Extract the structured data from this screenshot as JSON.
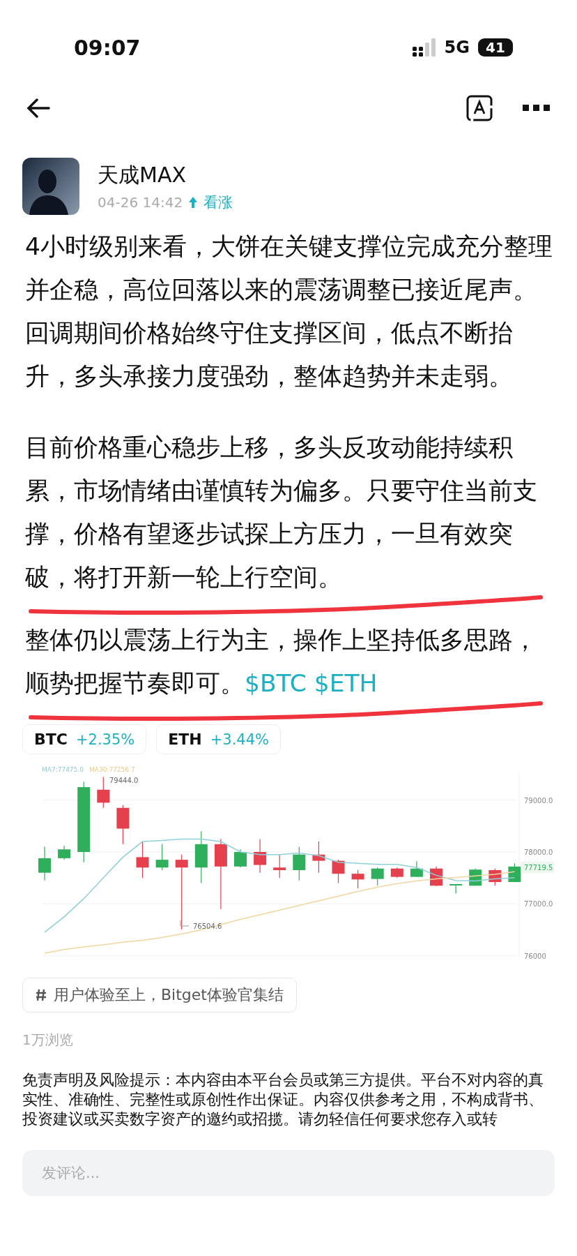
{
  "status_bar": {
    "time": "09:07",
    "network": "5G",
    "battery": "41"
  },
  "author": {
    "name": "天成MAX",
    "time": "04-26 14:42",
    "sentiment": "看涨"
  },
  "paragraphs": [
    {
      "text": "4小时级别来看，大饼在关键支撑位完成充分整理并企稳，高位回落以来的震荡调整已接近尾声。回调期间价格始终守住支撑区间，低点不断抬升，多头承接力度强劲，整体趋势并未走弱。"
    },
    {
      "text": "目前价格重心稳步上移，多头反攻动能持续积累，市场情绪由谨慎转为偏多。只要守住当前支撑，价格有望逐步试探上方压力，一旦有效突破，将打开新一轮上行空间。"
    },
    {
      "text": "整体仍以震荡上行为主，操作上坚持低多思路，顺势把握节奏即可。",
      "tickers": [
        "$BTC",
        "$ETH"
      ]
    }
  ],
  "coins": [
    {
      "symbol": "BTC",
      "change": "+2.35%"
    },
    {
      "symbol": "ETH",
      "change": "+3.44%"
    }
  ],
  "chart": {
    "ma_labels": [
      "MA7:77475.0",
      "MA30:77256.7"
    ],
    "high_label": "79444.0",
    "low_label": "76504.6",
    "last_price": "77719.5",
    "chart_data": {
      "type": "line",
      "ylim": [
        75955,
        79560
      ],
      "grid": true,
      "yticks": [
        {
          "value": 79000,
          "label": "79000.0"
        },
        {
          "value": 78000,
          "label": "78000.0"
        },
        {
          "value": 77000,
          "label": "77000.0"
        },
        {
          "value": 76000,
          "label": "76000"
        }
      ],
      "series": [
        {
          "color": "#8fd0d8",
          "values": [
            76450,
            76750,
            77100,
            77500,
            77900,
            78200,
            78220,
            78250,
            78250,
            78200,
            78000,
            77950,
            77950,
            77980,
            77930,
            77800,
            77780,
            77760,
            77760,
            77700,
            77550,
            77450,
            77440,
            77480,
            77500
          ]
        },
        {
          "color": "#f1d6a0",
          "values": [
            76050,
            76120,
            76170,
            76210,
            76260,
            76300,
            76350,
            76420,
            76500,
            76600,
            76700,
            76790,
            76880,
            76970,
            77060,
            77150,
            77240,
            77320,
            77390,
            77440,
            77480,
            77510,
            77540,
            77570,
            77620
          ]
        }
      ]
    }
  },
  "topic": "用户体验至上，Bitget体验官集结",
  "views": "1万浏览",
  "disclaimer": "免责声明及风险提示：本内容由本平台会员或第三方提供。平台不对内容的真实性、准确性、完整性或原创性作出保证。内容仅供参考之用，不构成背书、投资建议或买卖数字资产的邀约或招揽。请勿轻信任何要求您存入或转",
  "comment": {
    "placeholder": "发评论..."
  }
}
